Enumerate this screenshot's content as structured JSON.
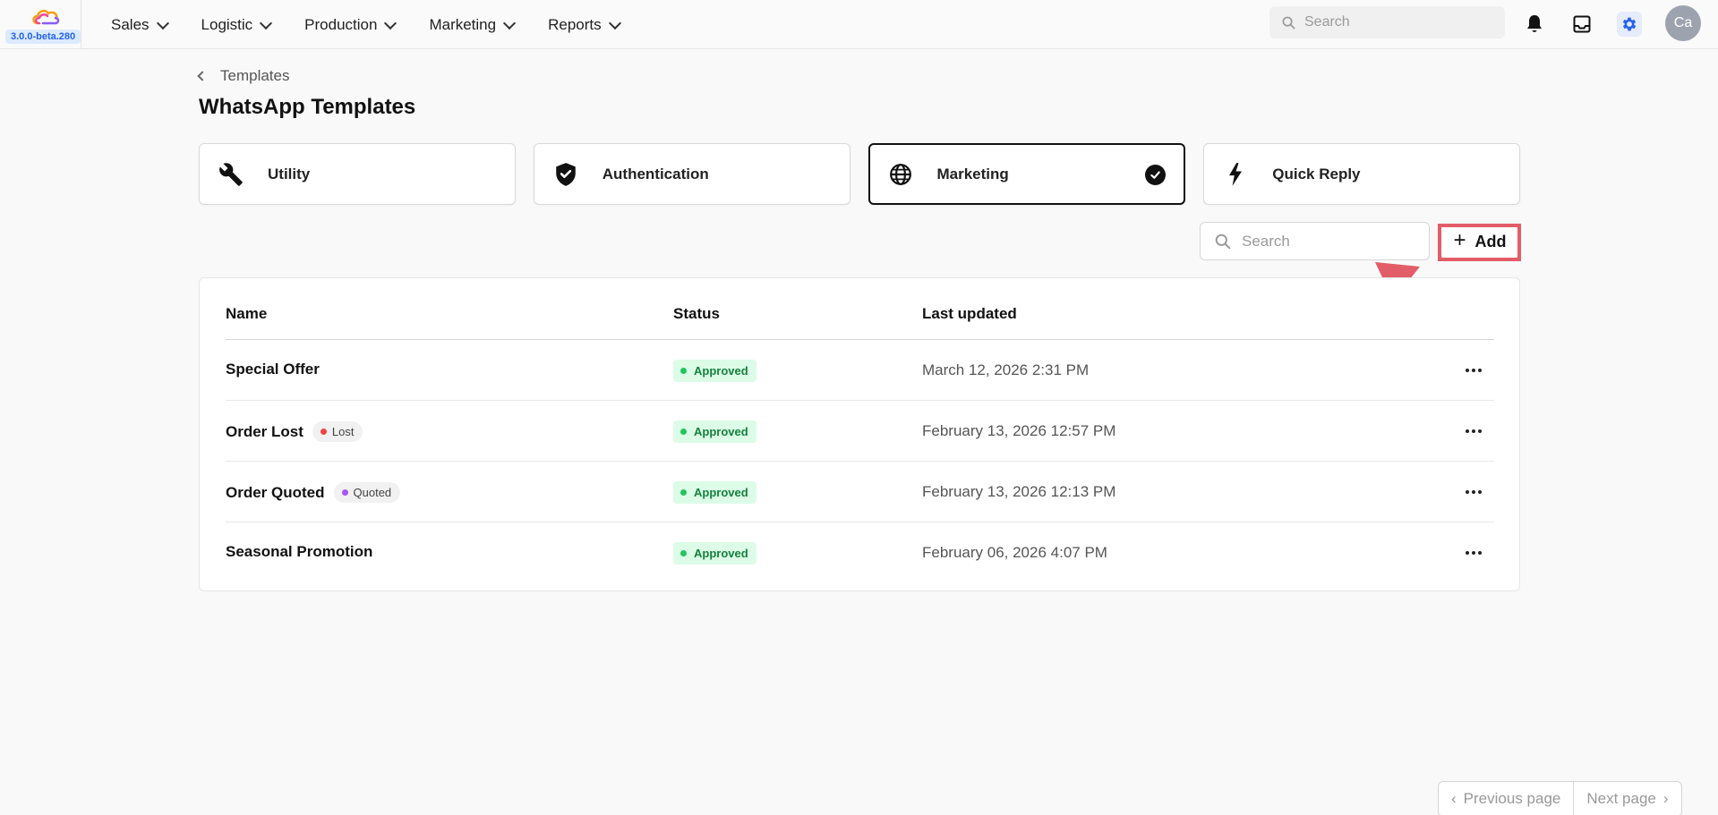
{
  "app": {
    "version": "3.0.0-beta.280",
    "nav": [
      {
        "label": "Sales"
      },
      {
        "label": "Logistic"
      },
      {
        "label": "Production"
      },
      {
        "label": "Marketing"
      },
      {
        "label": "Reports"
      }
    ],
    "search_placeholder": "Search",
    "avatar_initials": "Ca"
  },
  "breadcrumb": {
    "label": "Templates"
  },
  "page": {
    "title": "WhatsApp Templates"
  },
  "categories": [
    {
      "label": "Utility",
      "icon": "wrench-icon",
      "selected": false
    },
    {
      "label": "Authentication",
      "icon": "shield-check-icon",
      "selected": false
    },
    {
      "label": "Marketing",
      "icon": "globe-icon",
      "selected": true
    },
    {
      "label": "Quick Reply",
      "icon": "lightning-icon",
      "selected": false
    }
  ],
  "toolbar": {
    "search_placeholder": "Search",
    "add_label": "Add"
  },
  "table": {
    "columns": [
      "Name",
      "Status",
      "Last updated"
    ],
    "rows": [
      {
        "name": "Special Offer",
        "tag": null,
        "status": "Approved",
        "updated": "March 12, 2026 2:31 PM"
      },
      {
        "name": "Order Lost",
        "tag": "Lost",
        "status": "Approved",
        "updated": "February 13, 2026 12:57 PM"
      },
      {
        "name": "Order Quoted",
        "tag": "Quoted",
        "status": "Approved",
        "updated": "February 13, 2026 12:13 PM"
      },
      {
        "name": "Seasonal Promotion",
        "tag": null,
        "status": "Approved",
        "updated": "February 06, 2026 4:07 PM"
      }
    ]
  },
  "pagination": {
    "prev_label": "Previous page",
    "next_label": "Next page"
  },
  "colors": {
    "accent_blue": "#2563eb",
    "approved_bg": "#dcfce7",
    "approved_text": "#15803d",
    "lost_dot": "#ef4444",
    "quoted_dot": "#a855f7",
    "annotation_red": "#e35d68"
  }
}
